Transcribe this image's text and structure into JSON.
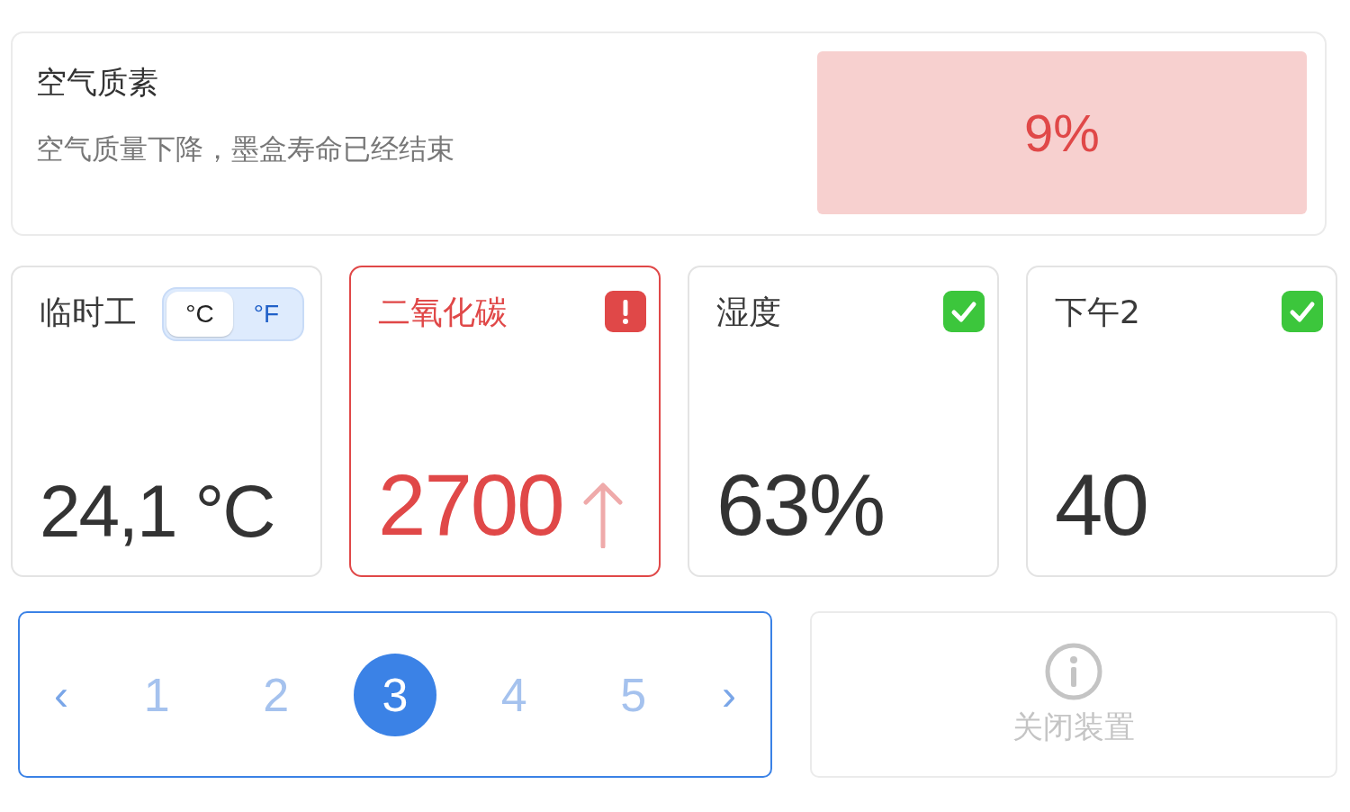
{
  "air_quality": {
    "title": "空气质素",
    "message": "空气质量下降，墨盒寿命已经结束",
    "value": "9%",
    "alert": true
  },
  "sensors": [
    {
      "title": "临时工",
      "value": "24,1 °C",
      "alert": false,
      "ok": false,
      "rising": false,
      "units": [
        {
          "label": "°C",
          "selected": true
        },
        {
          "label": "°F",
          "selected": false
        }
      ]
    },
    {
      "title": "二氧化碳",
      "value": "2700",
      "alert": true,
      "ok": false,
      "rising": true
    },
    {
      "title": "湿度",
      "value": "63%",
      "alert": false,
      "ok": true,
      "rising": false
    },
    {
      "title": "下午2",
      "value": "40",
      "alert": false,
      "ok": true,
      "rising": false
    }
  ],
  "pagination": {
    "prev": "‹",
    "next": "›",
    "pages": [
      {
        "label": "1",
        "selected": false
      },
      {
        "label": "2",
        "selected": false
      },
      {
        "label": "3",
        "selected": true
      },
      {
        "label": "4",
        "selected": false
      },
      {
        "label": "5",
        "selected": false
      }
    ]
  },
  "action": {
    "label": "关闭装置",
    "disabled": true
  }
}
